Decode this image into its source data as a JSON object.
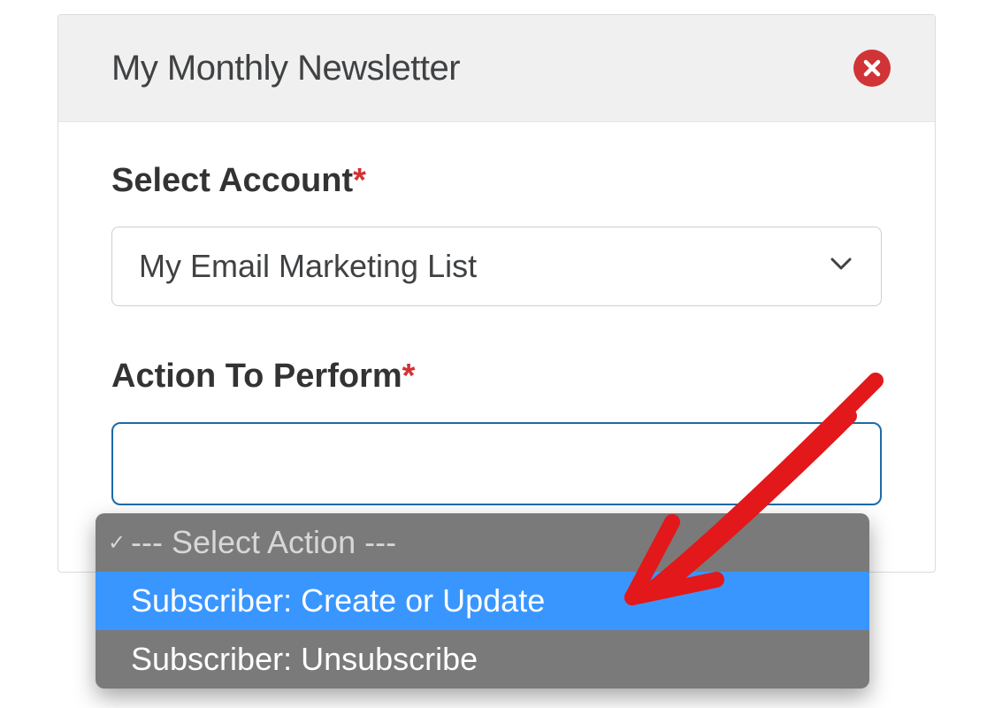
{
  "header": {
    "title": "My Monthly Newsletter"
  },
  "fields": {
    "account": {
      "label": "Select Account",
      "value": "My Email Marketing List",
      "required": true
    },
    "action": {
      "label": "Action To Perform",
      "required": true,
      "placeholder": "--- Select Action ---",
      "options": [
        "Subscriber: Create or Update",
        "Subscriber: Unsubscribe"
      ],
      "highlighted_index": 0
    }
  },
  "colors": {
    "danger": "#d13436",
    "highlight": "#3a96ff",
    "focus_border": "#1f6aa5",
    "panel_header_bg": "#f0f0f0",
    "dropdown_bg": "#7a7a7a"
  }
}
